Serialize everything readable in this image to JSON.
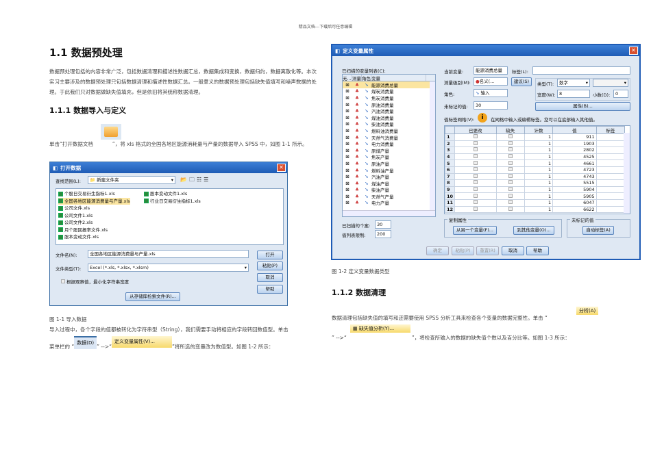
{
  "header": "精品文档---下载后可任意编辑",
  "section_title": "1.1 数据预处理",
  "intro": "数据预处理包括的内容非常广泛，包括数据清理和描述性数据汇总，数据集成和变换，数据归约，数据离散化等。本次实习主要涉及的数据预处理只包括数据清理和描述性数据汇总。一般意义的数据预处理包括缺失值填写和噪声数据的处理。于此我们只对数据做缺失值填充，但是依旧将其统称数据清理。",
  "sub1_title": "1.1.1 数据导入与定义",
  "sub1_p1a": "单击“打开数据文档",
  "sub1_p1b": "”，将 xls 格式的全国各地区能源消耗量与产量的数据导入 SPSS 中，如图 1-1 所示。",
  "open_dialog": {
    "title": "打开数据",
    "lookin_label": "查找范围(L):",
    "lookin_value": "新建文件夹",
    "files_col1": [
      "个股日交易衍生指标1.xls",
      "全国各地区能源消费量与产量.xls",
      "公司文件.xls",
      "公司文件1.xls",
      "公司文件2.xls",
      "月个股回报率文件.xls",
      "股本变动文件.xls"
    ],
    "files_col2": [
      "股本变动文件1.xls",
      "行业日交易衍生指标1.xls"
    ],
    "filename_label": "文件名(N):",
    "filename_value": "全国各地区能源消费量与产量.xls",
    "filetype_label": "文件类型(T):",
    "filetype_value": "Excel (*.xls, *.xlsx, *.xlsm)",
    "minimize_checkbox": "根据观察值，最小化字符串宽度",
    "open_btn": "打开",
    "paste_btn": "粘贴(P)",
    "cancel_btn": "取消",
    "help_btn": "帮助",
    "repo_btn": "从存储库检索文件(R)..."
  },
  "fig1_caption": "图 1-1 导入数据",
  "p2": "导入过程中，各个字段的值都被转化为字符串型（String），我们需要手动将相应的字段转回数值型。单击",
  "p3a": "菜单栏的 “",
  "menu_data": "数据(D)",
  "p3b": "” -->“",
  "menu_define": "定义变量属性(V)...",
  "p3c": "”将所选的变量改为数值型。如图 1-2 所示：",
  "var_dialog": {
    "title": "定义变量属性",
    "scanned_list_label": "已扫描的变量列表(C):",
    "list_headers": [
      "无...",
      "测量",
      "角色",
      "变量"
    ],
    "variables": [
      "能源消费总量",
      "煤炭消费量",
      "焦炭消费量",
      "原油消费量",
      "汽油消费量",
      "煤油消费量",
      "柴油消费量",
      "燃料油消费量",
      "天然气消费量",
      "电力消费量",
      "原煤产量",
      "焦炭产量",
      "原油产量",
      "燃料油产量",
      "汽油产量",
      "煤油产量",
      "柴油产量",
      "天然气产量",
      "电力产量"
    ],
    "scanned_cases_label": "已扫描的个案:",
    "scanned_cases": "30",
    "value_limit_label": "值列表限制:",
    "value_limit": "200",
    "current_var_label": "当前变量:",
    "current_var": "能源消费总量",
    "label_label": "标签(L):",
    "measure_label": "测量级别(M):",
    "measure_value": "名义(...",
    "suggest_btn": "建议(S)",
    "type_label": "类型(T):",
    "type_value": "数字",
    "role_label": "角色:",
    "role_value": "输入",
    "width_label": "宽度(W):",
    "width_value": "8",
    "decimals_label": "小数(D):",
    "decimals_value": "0",
    "unlabeled_label": "未标记的值:",
    "unlabeled_value": "30",
    "attributes_btn": "属性(B)...",
    "grid_label": "值标签网格(V):",
    "grid_hint": "在网格中输入或编辑标签。您可以在底部输入其他值。",
    "grid_headers": [
      "已更改",
      "缺失",
      "计数",
      "值",
      "标签"
    ],
    "grid_rows": [
      [
        "1",
        "1",
        "911"
      ],
      [
        "2",
        "1",
        "1903"
      ],
      [
        "3",
        "1",
        "2802"
      ],
      [
        "4",
        "1",
        "4525"
      ],
      [
        "5",
        "1",
        "4661"
      ],
      [
        "6",
        "1",
        "4723"
      ],
      [
        "7",
        "1",
        "4743"
      ],
      [
        "8",
        "1",
        "5515"
      ],
      [
        "9",
        "1",
        "5904"
      ],
      [
        "10",
        "1",
        "5905"
      ],
      [
        "11",
        "1",
        "6047"
      ],
      [
        "12",
        "1",
        "6622"
      ]
    ],
    "copy_group": "复制属性",
    "from_var_btn": "从另一个变量(F)...",
    "to_var_btn": "到其他变量(O)...",
    "unlabeled_group": "未标记的值",
    "auto_label_btn": "自动标签(A)",
    "ok_btn": "确定",
    "paste_btn": "粘贴(P)",
    "reset_btn": "重置(R)",
    "cancel_btn": "取消",
    "help_btn": "帮助"
  },
  "fig2_caption": "图 1-2 定义变量数据类型",
  "sub2_title": "1.1.2 数据清理",
  "p4": "数据清理包括缺失值的填写和还需要使用 SPSS 分析工具来检查各个变量的数据完整性。单击 “",
  "menu_analyze": "分析(A)",
  "p5a": "” -->“",
  "menu_missing": "缺失值分析(Y)...",
  "p5b": "”，将检查所输入的数据的缺失值个数以及百分比等。如图 1-3 所示："
}
